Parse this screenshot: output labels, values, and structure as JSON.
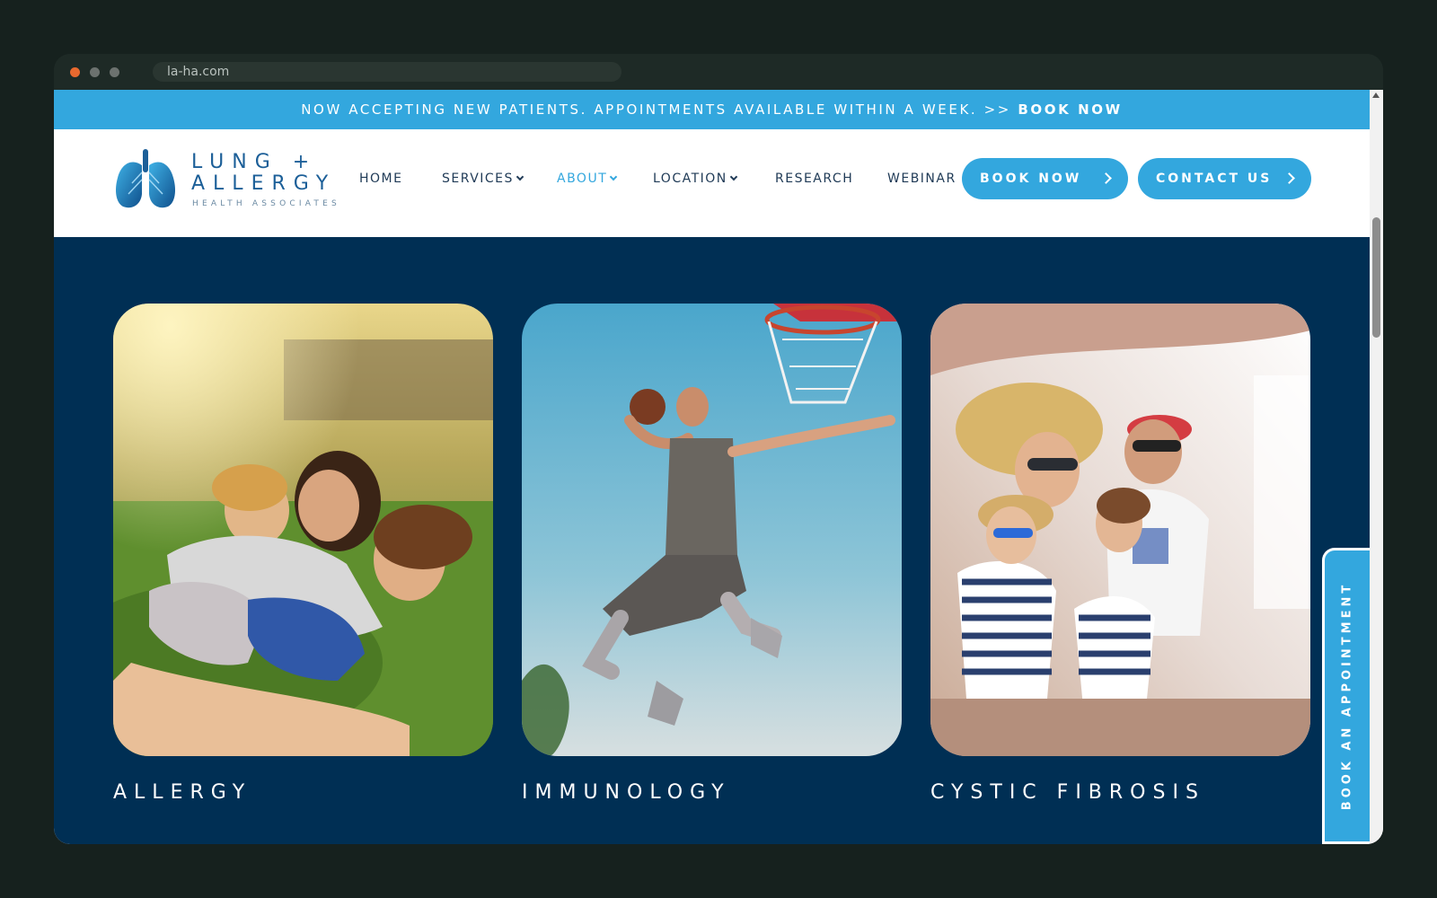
{
  "browser": {
    "url": "la-ha.com"
  },
  "announcement": {
    "lead": "NOW ACCEPTING NEW PATIENTS. APPOINTMENTS AVAILABLE WITHIN A WEEK. >>",
    "cta": "BOOK NOW"
  },
  "logo": {
    "line1": "LUNG +",
    "line2": "ALLERGY",
    "line3": "HEALTH ASSOCIATES"
  },
  "nav": {
    "items": [
      {
        "label": "HOME"
      },
      {
        "label": "SERVICES"
      },
      {
        "label": "ABOUT"
      },
      {
        "label": "LOCATION"
      },
      {
        "label": "RESEARCH"
      },
      {
        "label": "WEBINAR"
      }
    ],
    "active": "ABOUT"
  },
  "buttons": {
    "book_now": "BOOK NOW",
    "contact_us": "CONTACT US"
  },
  "cards": [
    {
      "title": "ALLERGY",
      "image": "family-on-grass-photo"
    },
    {
      "title": "IMMUNOLOGY",
      "image": "basketball-dunk-photo"
    },
    {
      "title": "CYSTIC FIBROSIS",
      "image": "family-on-boat-photo"
    }
  ],
  "side_tab": {
    "label": "BOOK AN APPOINTMENT"
  },
  "colors": {
    "accent": "#33a7de",
    "hero_bg": "#002f54",
    "nav_text": "#1f3a56",
    "logo_blue": "#1c5f98"
  }
}
